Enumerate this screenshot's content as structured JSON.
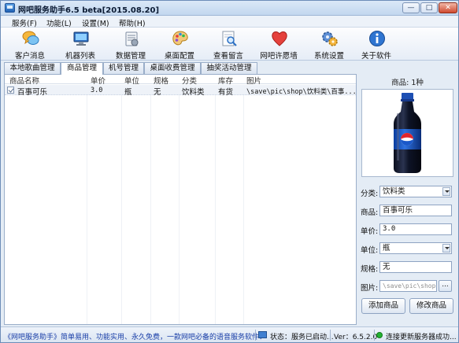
{
  "window": {
    "title": "网吧服务助手6.5 beta[2015.08.20]",
    "controls": {
      "minimize": "—",
      "maximize": "□",
      "close": "✕"
    }
  },
  "menu": [
    "服务(F)",
    "功能(L)",
    "设置(M)",
    "帮助(H)"
  ],
  "toolbar": [
    {
      "label": "客户消息",
      "icon": "chat-bubbles-icon"
    },
    {
      "label": "机器列表",
      "icon": "monitor-icon"
    },
    {
      "label": "数据管理",
      "icon": "database-icon"
    },
    {
      "label": "桌面配置",
      "icon": "palette-icon"
    },
    {
      "label": "查看留言",
      "icon": "message-search-icon"
    },
    {
      "label": "网吧许愿墙",
      "icon": "heart-icon"
    },
    {
      "label": "系统设置",
      "icon": "gears-icon"
    },
    {
      "label": "关于软件",
      "icon": "info-icon"
    }
  ],
  "tabs": [
    {
      "label": "本地歌曲管理",
      "active": false
    },
    {
      "label": "商品管理",
      "active": true
    },
    {
      "label": "机号管理",
      "active": false
    },
    {
      "label": "桌面收费管理",
      "active": false
    },
    {
      "label": "抽奖活动管理",
      "active": false
    }
  ],
  "table": {
    "columns": [
      "商品名称",
      "单价",
      "单位",
      "规格",
      "分类",
      "库存",
      "图片"
    ],
    "rows": [
      {
        "name": "百事可乐",
        "price": "3.0",
        "unit": "瓶",
        "spec": "无",
        "category": "饮料类",
        "stock": "有货",
        "image": "\\save\\pic\\shop\\饮料类\\百事..."
      }
    ]
  },
  "detail": {
    "header": "商品: 1种",
    "category_label": "分类:",
    "category_value": "饮料类",
    "name_label": "商品:",
    "name_value": "百事可乐",
    "price_label": "单价:",
    "price_value": "3.0",
    "unit_label": "单位:",
    "unit_value": "瓶",
    "spec_label": "规格:",
    "spec_value": "无",
    "image_label": "图片:",
    "image_value": "\\save\\pic\\shop\\",
    "browse_label": "...",
    "add_button": "添加商品",
    "edit_button": "修改商品"
  },
  "status": {
    "marquee": "《网吧服务助手》简单易用、功能实用、永久免费，一款网吧必备的语音服务软件！",
    "service": "状态：服务已启动...",
    "version": "Ver：6.5.2.0",
    "connection": "连接更新服务器成功..."
  },
  "colors": {
    "accent": "#3f7fd0",
    "window_bg": "#e4ecf5",
    "status_ok": "#22b332",
    "marquee_text": "#1a3fa8"
  }
}
